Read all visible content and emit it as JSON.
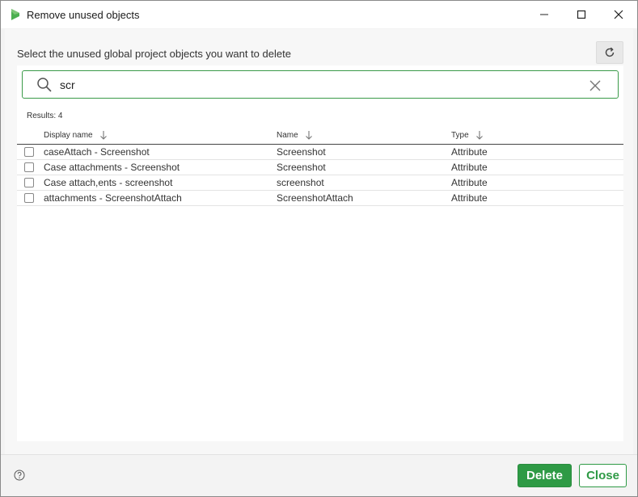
{
  "window": {
    "title": "Remove unused objects",
    "app_icon": "app-logo-icon",
    "controls": [
      "minimize-icon",
      "maximize-icon",
      "close-icon"
    ]
  },
  "dialog": {
    "instruction": "Select the unused global project objects you want to delete",
    "refresh_icon": "refresh-icon"
  },
  "search": {
    "value": "scr",
    "placeholder": "",
    "icon": "search-icon",
    "clear_icon": "clear-icon"
  },
  "results_label": "Results: 4",
  "table": {
    "columns": [
      {
        "label": "Display name",
        "sort_icon": "arrow-down-icon"
      },
      {
        "label": "Name",
        "sort_icon": "arrow-down-icon"
      },
      {
        "label": "Type",
        "sort_icon": "arrow-down-icon"
      }
    ],
    "rows": [
      {
        "display_name": "caseAttach - Screenshot",
        "name": "Screenshot",
        "type": "Attribute",
        "checked": false
      },
      {
        "display_name": "Case attachments - Screenshot",
        "name": "Screenshot",
        "type": "Attribute",
        "checked": false
      },
      {
        "display_name": "Case attach,ents - screenshot",
        "name": "screenshot",
        "type": "Attribute",
        "checked": false
      },
      {
        "display_name": "attachments - ScreenshotAttach",
        "name": "ScreenshotAttach",
        "type": "Attribute",
        "checked": false
      }
    ]
  },
  "footer": {
    "help_icon": "help-icon",
    "delete_label": "Delete",
    "close_label": "Close"
  },
  "colors": {
    "accent": "#2e9a45",
    "search_border": "#3a9a48",
    "app_icon": "#4caf50"
  }
}
